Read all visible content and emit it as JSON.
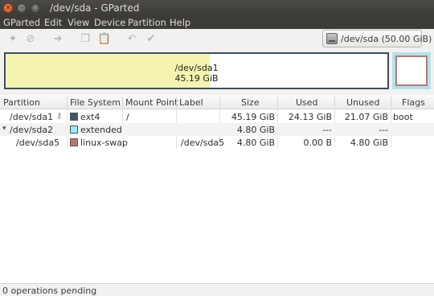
{
  "window": {
    "title": "/dev/sda - GParted",
    "close_glyph": "×",
    "min_glyph": "–",
    "max_glyph": "□"
  },
  "menu": [
    "GParted",
    "Edit",
    "View",
    "Device",
    "Partition",
    "Help"
  ],
  "toolbar": {
    "buttons": [
      {
        "name": "new-partition-icon",
        "glyph": "✦"
      },
      {
        "name": "delete-partition-icon",
        "glyph": "⊘"
      },
      {
        "name": "resize-move-icon",
        "glyph": "➜"
      },
      {
        "name": "copy-icon",
        "glyph": "❐"
      },
      {
        "name": "paste-icon",
        "glyph": "📋"
      },
      {
        "name": "undo-icon",
        "glyph": "↶"
      },
      {
        "name": "apply-icon",
        "glyph": "✔"
      }
    ],
    "device": "/dev/sda  (50.00 GiB)"
  },
  "graph": {
    "partition1": {
      "name": "/dev/sda1",
      "size": "45.19 GiB",
      "used_fraction": 0.535
    },
    "colors": {
      "ext4_border": "#394f5c",
      "used_fill": "#f4f4b0",
      "extended": "#aee4ec",
      "swap": "#c0766c"
    }
  },
  "table": {
    "headers": [
      "Partition",
      "File System",
      "Mount Point",
      "Label",
      "Size",
      "Used",
      "Unused",
      "Flags"
    ],
    "rows": [
      {
        "partition": "/dev/sda1",
        "key_icon": "key-icon",
        "fs": "ext4",
        "fs_color": "#3f5868",
        "mount": "/",
        "label": "",
        "size": "45.19 GiB",
        "used": "24.13 GiB",
        "unused": "21.07 GiB",
        "flags": "boot"
      },
      {
        "partition": "/dev/sda2",
        "expander": "▾",
        "fs": "extended",
        "fs_color": "#8eeefc",
        "mount": "",
        "label": "",
        "size": "4.80 GiB",
        "used": "---",
        "unused": "---",
        "flags": ""
      },
      {
        "partition": "/dev/sda5",
        "fs": "linux-swap",
        "fs_color": "#c0766c",
        "mount": "",
        "label": "/dev/sda5",
        "size": "4.80 GiB",
        "used": "0.00 B",
        "unused": "4.80 GiB",
        "flags": ""
      }
    ]
  },
  "status": "0 operations pending"
}
